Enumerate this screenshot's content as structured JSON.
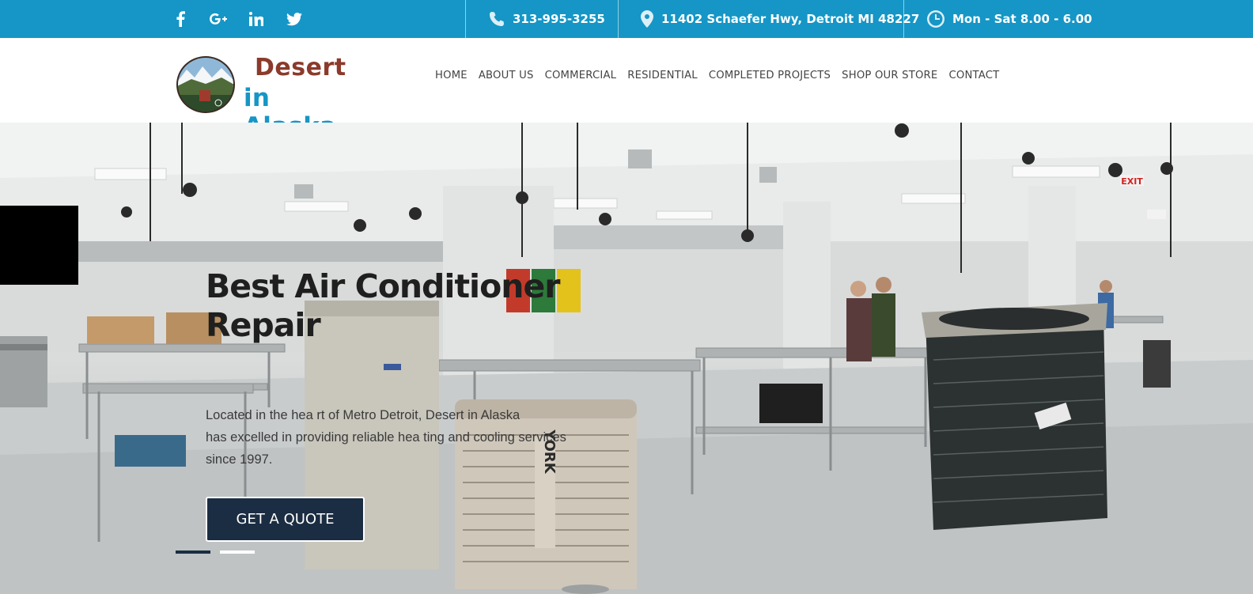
{
  "topbar": {
    "social": [
      {
        "icon": "facebook-icon"
      },
      {
        "icon": "google-plus-icon"
      },
      {
        "icon": "linkedin-icon"
      },
      {
        "icon": "twitter-icon"
      }
    ],
    "phone": "313-995-3255",
    "address": "11402 Schaefer Hwy, Detroit MI 48227",
    "hours": "Mon - Sat 8.00 - 6.00",
    "background_color": "#1596c6"
  },
  "logo": {
    "line1": "Desert",
    "line2": "in Alaska",
    "line1_color": "#8b3a2b",
    "line2_color": "#1596c6"
  },
  "nav": {
    "items": [
      {
        "label": "HOME"
      },
      {
        "label": "ABOUT US"
      },
      {
        "label": "COMMERCIAL"
      },
      {
        "label": "RESIDENTIAL"
      },
      {
        "label": "COMPLETED PROJECTS"
      },
      {
        "label": "SHOP OUR STORE"
      },
      {
        "label": "CONTACT"
      }
    ]
  },
  "hero": {
    "title_line1": "Best Air Conditioner",
    "title_line2": "Repair",
    "text_line1": "Located in the hea rt of Metro Detroit, Desert in Alaska",
    "text_line2": "has excelled in providing reliable hea ting and cooling services",
    "text_line3": "since 1997.",
    "button_label": "GET A QUOTE",
    "unit_brand": "YORK",
    "exit_sign": "EXIT",
    "button_color": "#1b2d42",
    "slides": 2,
    "active_slide": 1
  }
}
